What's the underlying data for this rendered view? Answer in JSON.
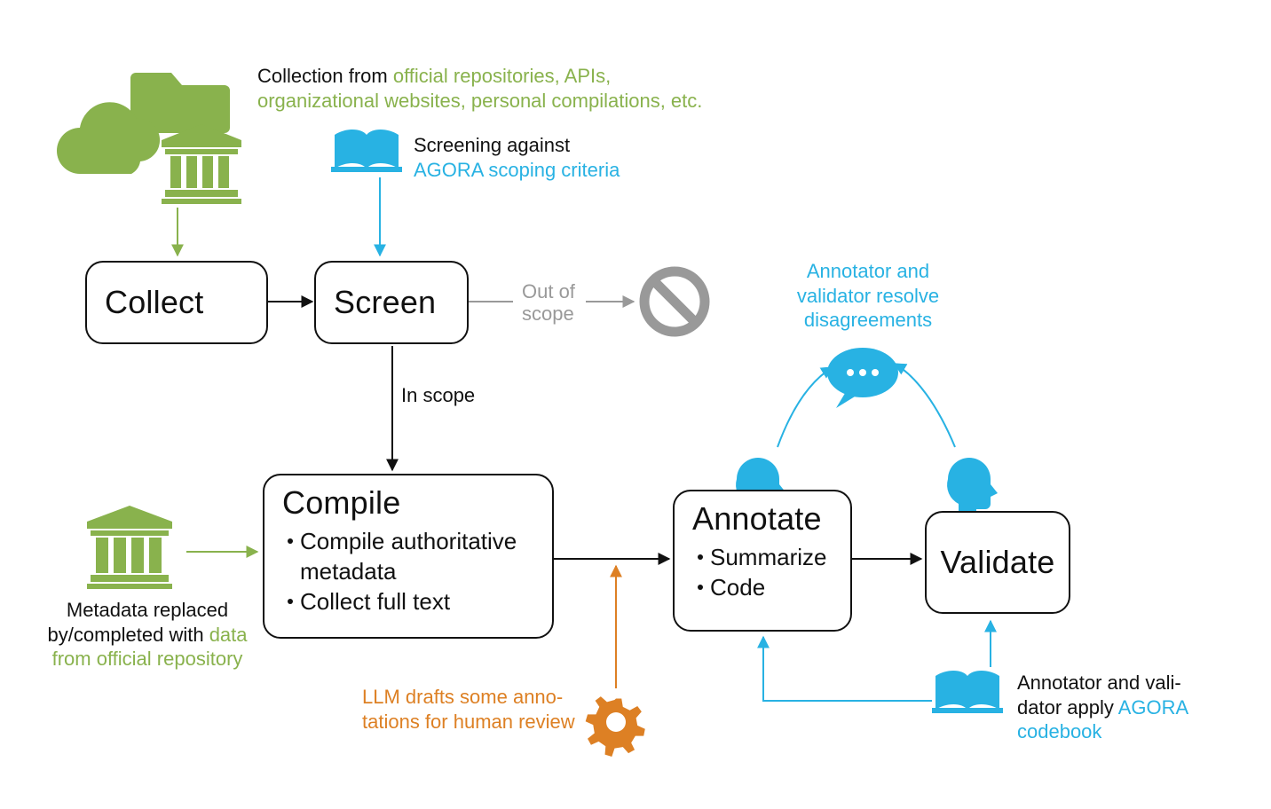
{
  "nodes": {
    "collect": {
      "title": "Collect"
    },
    "screen": {
      "title": "Screen"
    },
    "compile": {
      "title": "Compile",
      "bullets": [
        "Compile authoritative metadata",
        "Collect full text"
      ]
    },
    "annotate": {
      "title": "Annotate",
      "bullets": [
        "Summarize",
        "Code"
      ]
    },
    "validate": {
      "title": "Validate"
    }
  },
  "edges": {
    "screen_inscope": "In scope",
    "screen_outofscope": "Out of scope"
  },
  "annotations": {
    "collect_sources": {
      "prefix": "Collection from ",
      "highlight": "official repositories, APIs, organizational websites, personal compilations, etc."
    },
    "screening_criteria": {
      "prefix": "Screening against ",
      "highlight": "AGORA scoping criteria"
    },
    "metadata_replaced": {
      "prefix": "Metadata replaced by/completed with ",
      "highlight": "data from official repository"
    },
    "llm_drafts": "LLM drafts some anno-tations for human review",
    "resolve_disagreements": "Annotator and validator resolve disagreements",
    "apply_codebook": {
      "prefix": "Annotator and vali-dator apply ",
      "highlight": "AGORA codebook"
    }
  },
  "colors": {
    "green": "#89b24d",
    "cyan": "#28b2e3",
    "orange": "#dd8024",
    "gray": "#999999",
    "black": "#111111"
  }
}
